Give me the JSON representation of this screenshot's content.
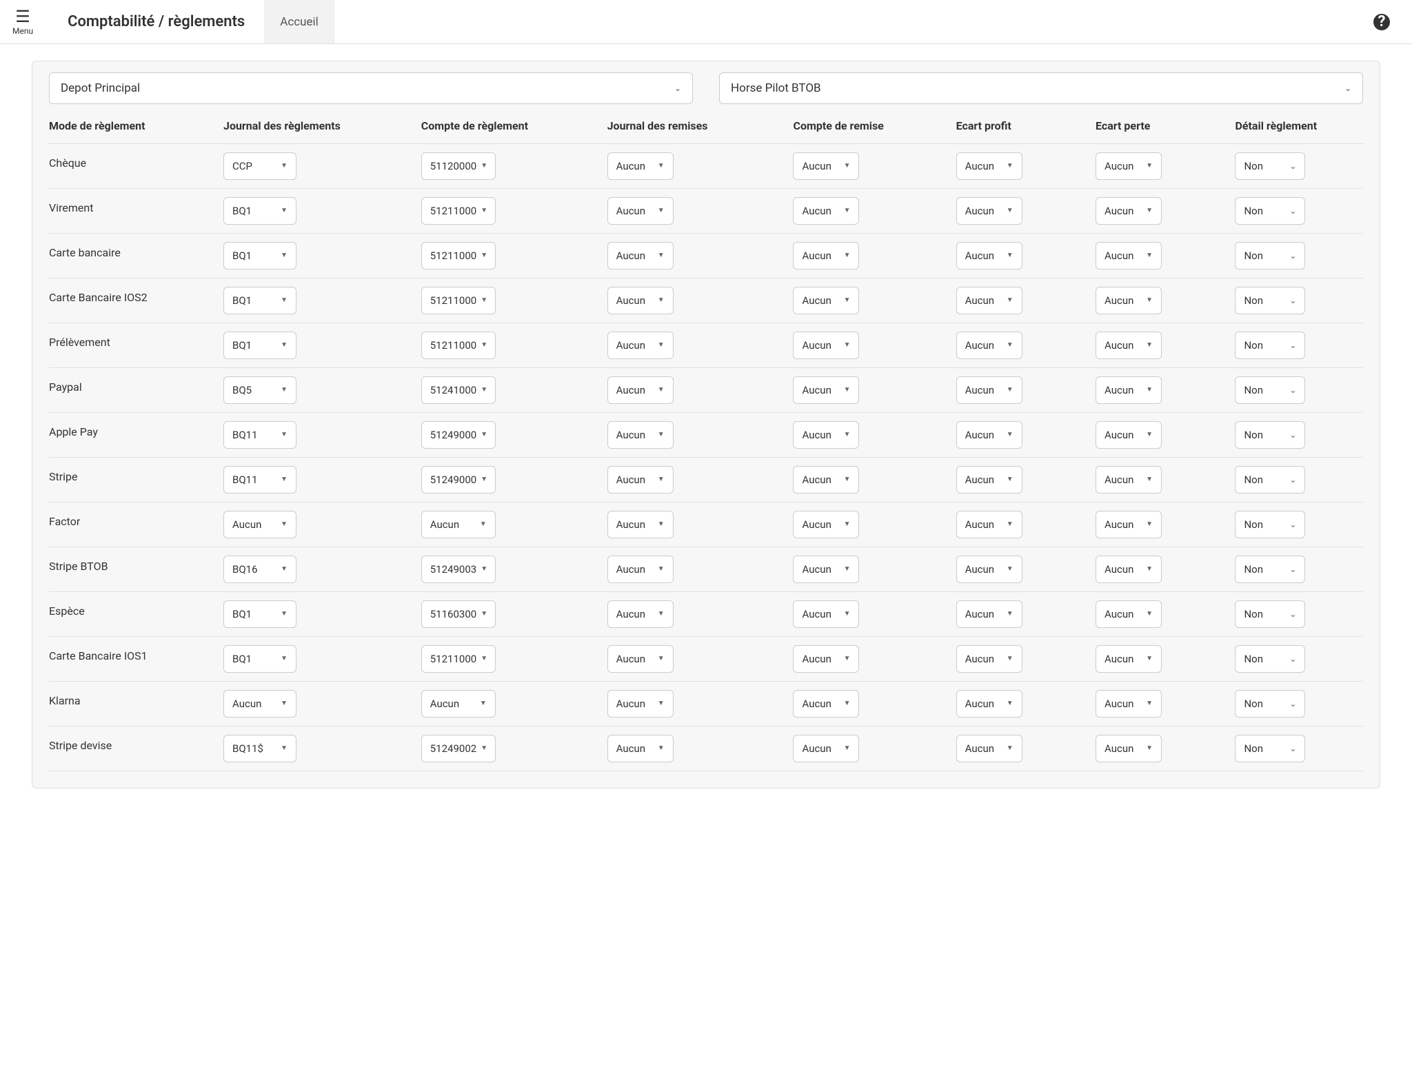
{
  "header": {
    "menu_label": "Menu",
    "title": "Comptabilité / règlements",
    "tab_accueil": "Accueil"
  },
  "filters": {
    "select1": "Depot Principal",
    "select2": "Horse Pilot BTOB"
  },
  "columns": {
    "mode": "Mode de règlement",
    "journal": "Journal des règlements",
    "compte": "Compte de règlement",
    "journal_remises": "Journal des remises",
    "compte_remise": "Compte de remise",
    "ecart_profit": "Ecart profit",
    "ecart_perte": "Ecart perte",
    "detail": "Détail règlement"
  },
  "rows": [
    {
      "mode": "Chèque",
      "journal": "CCP",
      "compte": "51120000",
      "journal_remises": "Aucun",
      "compte_remise": "Aucun",
      "ecart_profit": "Aucun",
      "ecart_perte": "Aucun",
      "detail": "Non"
    },
    {
      "mode": "Virement",
      "journal": "BQ1",
      "compte": "51211000",
      "journal_remises": "Aucun",
      "compte_remise": "Aucun",
      "ecart_profit": "Aucun",
      "ecart_perte": "Aucun",
      "detail": "Non"
    },
    {
      "mode": "Carte bancaire",
      "journal": "BQ1",
      "compte": "51211000",
      "journal_remises": "Aucun",
      "compte_remise": "Aucun",
      "ecart_profit": "Aucun",
      "ecart_perte": "Aucun",
      "detail": "Non"
    },
    {
      "mode": "Carte Bancaire IOS2",
      "journal": "BQ1",
      "compte": "51211000",
      "journal_remises": "Aucun",
      "compte_remise": "Aucun",
      "ecart_profit": "Aucun",
      "ecart_perte": "Aucun",
      "detail": "Non"
    },
    {
      "mode": "Prélèvement",
      "journal": "BQ1",
      "compte": "51211000",
      "journal_remises": "Aucun",
      "compte_remise": "Aucun",
      "ecart_profit": "Aucun",
      "ecart_perte": "Aucun",
      "detail": "Non"
    },
    {
      "mode": "Paypal",
      "journal": "BQ5",
      "compte": "51241000",
      "journal_remises": "Aucun",
      "compte_remise": "Aucun",
      "ecart_profit": "Aucun",
      "ecart_perte": "Aucun",
      "detail": "Non"
    },
    {
      "mode": "Apple Pay",
      "journal": "BQ11",
      "compte": "51249000",
      "journal_remises": "Aucun",
      "compte_remise": "Aucun",
      "ecart_profit": "Aucun",
      "ecart_perte": "Aucun",
      "detail": "Non"
    },
    {
      "mode": "Stripe",
      "journal": "BQ11",
      "compte": "51249000",
      "journal_remises": "Aucun",
      "compte_remise": "Aucun",
      "ecart_profit": "Aucun",
      "ecart_perte": "Aucun",
      "detail": "Non"
    },
    {
      "mode": "Factor",
      "journal": "Aucun",
      "compte": "Aucun",
      "journal_remises": "Aucun",
      "compte_remise": "Aucun",
      "ecart_profit": "Aucun",
      "ecart_perte": "Aucun",
      "detail": "Non"
    },
    {
      "mode": "Stripe BTOB",
      "journal": "BQ16",
      "compte": "51249003",
      "journal_remises": "Aucun",
      "compte_remise": "Aucun",
      "ecart_profit": "Aucun",
      "ecart_perte": "Aucun",
      "detail": "Non"
    },
    {
      "mode": "Espèce",
      "journal": "BQ1",
      "compte": "51160300",
      "journal_remises": "Aucun",
      "compte_remise": "Aucun",
      "ecart_profit": "Aucun",
      "ecart_perte": "Aucun",
      "detail": "Non"
    },
    {
      "mode": "Carte Bancaire IOS1",
      "journal": "BQ1",
      "compte": "51211000",
      "journal_remises": "Aucun",
      "compte_remise": "Aucun",
      "ecart_profit": "Aucun",
      "ecart_perte": "Aucun",
      "detail": "Non"
    },
    {
      "mode": "Klarna",
      "journal": "Aucun",
      "compte": "Aucun",
      "journal_remises": "Aucun",
      "compte_remise": "Aucun",
      "ecart_profit": "Aucun",
      "ecart_perte": "Aucun",
      "detail": "Non"
    },
    {
      "mode": "Stripe devise",
      "journal": "BQ11$",
      "compte": "51249002",
      "journal_remises": "Aucun",
      "compte_remise": "Aucun",
      "ecart_profit": "Aucun",
      "ecart_perte": "Aucun",
      "detail": "Non"
    }
  ]
}
